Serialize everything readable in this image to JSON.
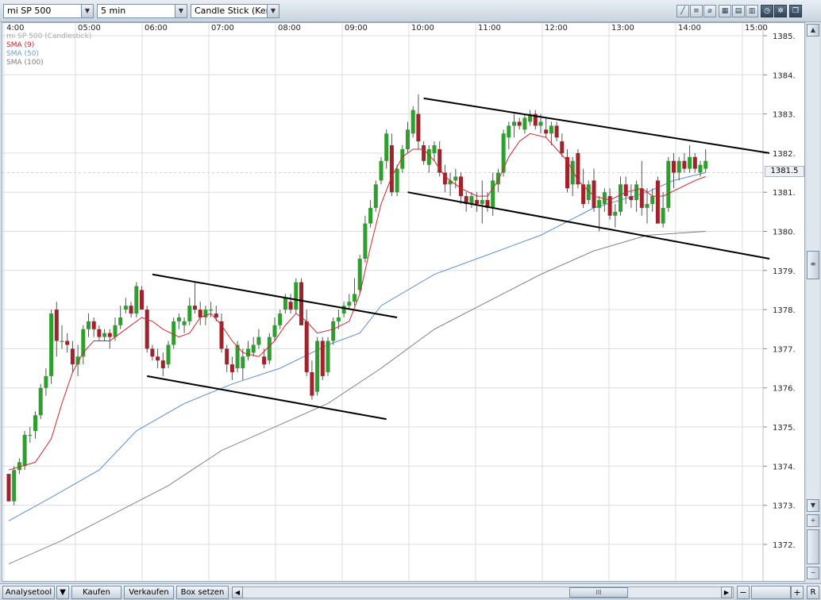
{
  "toolbar": {
    "symbol": "mi SP 500",
    "interval": "5 min",
    "chart_style": "Candle Stick (Kerze"
  },
  "legend": {
    "instrument": "mi SP 500 (Candlestick)",
    "sma9": "SMA (9)",
    "sma50": "SMA (50)",
    "sma100": "SMA (100)"
  },
  "last_price": "1381.5",
  "colors": {
    "up": "#2e9e2e",
    "down": "#a0222a",
    "sma9": "#d0262d",
    "sma50": "#5b8fd6",
    "sma100": "#777777",
    "trendline": "#000000",
    "grid": "#d9dde2"
  },
  "bottom": {
    "tab1": "Analysetool",
    "tab2": "Kaufen",
    "tab3": "Verkaufen",
    "tab4": "Box setzen",
    "r_label": "R",
    "thumb_grip": "III"
  },
  "chart_data": {
    "type": "candlestick",
    "interval_minutes": 5,
    "x_ticks": [
      "4:00",
      "05:00",
      "06:00",
      "07:00",
      "08:00",
      "09:00",
      "10:00",
      "11:00",
      "12:00",
      "13:00",
      "14:00",
      "15:00"
    ],
    "y_ticks": [
      "1372.",
      "1373.",
      "1374.",
      "1375.",
      "1376.",
      "1377.",
      "1378.",
      "1379.",
      "1380.",
      "1381.",
      "1382.",
      "1383.",
      "1384.",
      "1385."
    ],
    "ylim": [
      1371.4,
      1385.2
    ],
    "grid": true,
    "candles": [
      [
        1373.8,
        1373.8,
        1373.1,
        1373.1
      ],
      [
        1373.1,
        1374.0,
        1373.0,
        1373.9
      ],
      [
        1373.9,
        1374.2,
        1373.8,
        1374.1
      ],
      [
        1374.0,
        1374.9,
        1373.9,
        1374.8
      ],
      [
        1374.8,
        1375.0,
        1374.6,
        1374.8
      ],
      [
        1374.9,
        1375.4,
        1374.7,
        1375.3
      ],
      [
        1375.3,
        1376.1,
        1375.2,
        1376.0
      ],
      [
        1376.0,
        1376.5,
        1375.8,
        1376.3
      ],
      [
        1376.3,
        1378.0,
        1376.1,
        1377.9
      ],
      [
        1378.0,
        1378.2,
        1376.8,
        1377.2
      ],
      [
        1377.2,
        1377.6,
        1377.0,
        1377.2
      ],
      [
        1377.2,
        1377.4,
        1376.9,
        1377.1
      ],
      [
        1377.0,
        1377.2,
        1376.4,
        1376.6
      ],
      [
        1376.6,
        1377.1,
        1376.3,
        1376.8
      ],
      [
        1376.8,
        1377.6,
        1376.6,
        1377.5
      ],
      [
        1377.5,
        1377.9,
        1377.3,
        1377.7
      ],
      [
        1377.7,
        1377.8,
        1377.3,
        1377.5
      ],
      [
        1377.5,
        1377.6,
        1377.2,
        1377.3
      ],
      [
        1377.3,
        1377.5,
        1377.2,
        1377.4
      ],
      [
        1377.4,
        1377.5,
        1377.0,
        1377.3
      ],
      [
        1377.3,
        1377.8,
        1377.2,
        1377.6
      ],
      [
        1377.6,
        1378.1,
        1377.5,
        1377.8
      ],
      [
        1378.0,
        1378.3,
        1377.9,
        1378.1
      ],
      [
        1378.1,
        1378.2,
        1377.8,
        1377.9
      ],
      [
        1377.9,
        1378.7,
        1377.8,
        1378.6
      ],
      [
        1378.5,
        1378.6,
        1378.0,
        1378.0
      ],
      [
        1378.0,
        1378.1,
        1376.9,
        1377.0
      ],
      [
        1377.0,
        1377.1,
        1376.7,
        1376.8
      ],
      [
        1376.8,
        1377.0,
        1376.5,
        1376.7
      ],
      [
        1376.7,
        1376.9,
        1376.3,
        1376.5
      ],
      [
        1376.6,
        1377.2,
        1376.5,
        1377.1
      ],
      [
        1377.1,
        1377.8,
        1377.0,
        1377.7
      ],
      [
        1377.7,
        1377.9,
        1377.5,
        1377.8
      ],
      [
        1377.6,
        1377.8,
        1377.4,
        1377.7
      ],
      [
        1377.7,
        1378.3,
        1377.6,
        1378.1
      ],
      [
        1378.1,
        1378.7,
        1377.9,
        1378.0
      ],
      [
        1378.0,
        1378.2,
        1377.6,
        1377.8
      ],
      [
        1377.8,
        1378.1,
        1377.6,
        1378.0
      ],
      [
        1378.0,
        1378.2,
        1377.8,
        1378.0
      ],
      [
        1377.9,
        1378.1,
        1377.7,
        1377.8
      ],
      [
        1377.7,
        1377.9,
        1376.9,
        1377.0
      ],
      [
        1377.0,
        1377.1,
        1376.4,
        1376.6
      ],
      [
        1376.6,
        1376.8,
        1376.2,
        1376.4
      ],
      [
        1376.5,
        1377.2,
        1376.4,
        1377.1
      ],
      [
        1376.5,
        1377.0,
        1376.2,
        1376.8
      ],
      [
        1376.8,
        1377.2,
        1376.7,
        1377.0
      ],
      [
        1376.9,
        1377.3,
        1376.8,
        1377.1
      ],
      [
        1377.1,
        1377.5,
        1377.0,
        1377.3
      ],
      [
        1376.8,
        1377.0,
        1376.5,
        1376.6
      ],
      [
        1376.7,
        1377.4,
        1376.6,
        1377.3
      ],
      [
        1377.3,
        1377.8,
        1377.2,
        1377.6
      ],
      [
        1377.6,
        1378.0,
        1377.5,
        1377.9
      ],
      [
        1378.0,
        1378.4,
        1377.9,
        1378.3
      ],
      [
        1378.2,
        1378.4,
        1377.9,
        1378.0
      ],
      [
        1378.0,
        1378.8,
        1377.9,
        1378.7
      ],
      [
        1378.7,
        1378.8,
        1377.6,
        1377.6
      ],
      [
        1377.7,
        1378.0,
        1376.3,
        1376.4
      ],
      [
        1376.4,
        1376.7,
        1375.7,
        1375.8
      ],
      [
        1375.9,
        1377.3,
        1375.8,
        1377.2
      ],
      [
        1377.2,
        1377.3,
        1376.2,
        1376.3
      ],
      [
        1376.4,
        1377.3,
        1376.3,
        1377.2
      ],
      [
        1377.2,
        1377.8,
        1377.1,
        1377.7
      ],
      [
        1377.7,
        1378.0,
        1377.5,
        1377.8
      ],
      [
        1377.9,
        1378.2,
        1377.8,
        1378.1
      ],
      [
        1378.1,
        1378.4,
        1378.0,
        1378.2
      ],
      [
        1378.2,
        1378.8,
        1378.1,
        1378.4
      ],
      [
        1378.5,
        1379.4,
        1378.4,
        1379.3
      ],
      [
        1379.3,
        1380.4,
        1379.2,
        1380.2
      ],
      [
        1380.2,
        1380.8,
        1380.1,
        1380.6
      ],
      [
        1380.6,
        1381.3,
        1380.5,
        1381.2
      ],
      [
        1381.3,
        1381.9,
        1381.2,
        1381.8
      ],
      [
        1381.8,
        1382.6,
        1381.6,
        1382.5
      ],
      [
        1382.2,
        1382.5,
        1380.9,
        1381.0
      ],
      [
        1381.0,
        1381.7,
        1380.9,
        1381.6
      ],
      [
        1381.6,
        1382.2,
        1381.5,
        1382.1
      ],
      [
        1382.1,
        1382.8,
        1382.0,
        1382.6
      ],
      [
        1382.5,
        1383.2,
        1382.4,
        1383.1
      ],
      [
        1383.0,
        1383.5,
        1382.1,
        1382.3
      ],
      [
        1382.2,
        1382.3,
        1381.7,
        1381.8
      ],
      [
        1381.7,
        1382.2,
        1381.5,
        1382.1
      ],
      [
        1382.0,
        1382.3,
        1381.8,
        1382.2
      ],
      [
        1382.1,
        1382.3,
        1381.4,
        1381.5
      ],
      [
        1381.5,
        1381.7,
        1381.0,
        1381.2
      ],
      [
        1381.2,
        1381.5,
        1380.9,
        1381.3
      ],
      [
        1381.3,
        1381.6,
        1381.1,
        1381.4
      ],
      [
        1381.4,
        1381.5,
        1380.7,
        1380.9
      ],
      [
        1380.9,
        1381.0,
        1380.5,
        1380.7
      ],
      [
        1380.7,
        1381.0,
        1380.6,
        1380.9
      ],
      [
        1380.8,
        1381.0,
        1380.5,
        1380.7
      ],
      [
        1380.7,
        1381.3,
        1380.2,
        1380.8
      ],
      [
        1380.8,
        1381.0,
        1380.5,
        1380.6
      ],
      [
        1380.6,
        1381.5,
        1380.4,
        1381.3
      ],
      [
        1381.2,
        1381.6,
        1381.0,
        1381.5
      ],
      [
        1381.5,
        1382.6,
        1381.4,
        1382.5
      ],
      [
        1382.4,
        1382.8,
        1382.1,
        1382.7
      ],
      [
        1382.7,
        1383.0,
        1382.4,
        1382.8
      ],
      [
        1382.8,
        1382.9,
        1382.6,
        1382.7
      ],
      [
        1382.6,
        1383.0,
        1382.5,
        1382.9
      ],
      [
        1382.8,
        1383.1,
        1382.7,
        1383.0
      ],
      [
        1383.0,
        1383.1,
        1382.6,
        1382.7
      ],
      [
        1382.7,
        1383.0,
        1382.5,
        1382.8
      ],
      [
        1382.6,
        1382.9,
        1382.4,
        1382.5
      ],
      [
        1382.5,
        1382.8,
        1382.2,
        1382.7
      ],
      [
        1382.7,
        1382.8,
        1382.3,
        1382.4
      ],
      [
        1382.3,
        1382.5,
        1381.9,
        1382.0
      ],
      [
        1381.9,
        1382.1,
        1381.0,
        1381.1
      ],
      [
        1381.2,
        1381.9,
        1380.9,
        1381.8
      ],
      [
        1382.0,
        1382.1,
        1381.1,
        1381.2
      ],
      [
        1381.2,
        1381.6,
        1380.6,
        1380.7
      ],
      [
        1380.8,
        1381.3,
        1380.7,
        1381.2
      ],
      [
        1381.3,
        1381.6,
        1380.5,
        1380.6
      ],
      [
        1380.6,
        1380.9,
        1380.0,
        1380.8
      ],
      [
        1380.7,
        1381.1,
        1380.5,
        1381.0
      ],
      [
        1380.9,
        1381.1,
        1380.3,
        1380.4
      ],
      [
        1380.4,
        1380.7,
        1380.1,
        1380.5
      ],
      [
        1380.5,
        1381.4,
        1380.4,
        1381.2
      ],
      [
        1381.2,
        1381.4,
        1380.7,
        1380.9
      ],
      [
        1380.9,
        1381.2,
        1380.6,
        1380.8
      ],
      [
        1380.8,
        1381.3,
        1380.5,
        1381.2
      ],
      [
        1381.1,
        1381.8,
        1380.4,
        1380.6
      ],
      [
        1380.6,
        1381.1,
        1380.2,
        1380.7
      ],
      [
        1380.7,
        1381.1,
        1380.5,
        1380.9
      ],
      [
        1381.3,
        1381.4,
        1380.2,
        1380.2
      ],
      [
        1380.2,
        1381.0,
        1380.1,
        1380.6
      ],
      [
        1380.6,
        1381.9,
        1380.5,
        1381.8
      ],
      [
        1381.8,
        1382.0,
        1381.1,
        1381.5
      ],
      [
        1381.5,
        1381.9,
        1381.3,
        1381.8
      ],
      [
        1381.8,
        1382.0,
        1381.5,
        1381.6
      ],
      [
        1381.6,
        1382.2,
        1381.5,
        1381.9
      ],
      [
        1381.9,
        1382.0,
        1381.5,
        1381.6
      ],
      [
        1381.5,
        1381.8,
        1381.4,
        1381.7
      ],
      [
        1381.6,
        1382.1,
        1381.5,
        1381.8
      ]
    ],
    "sma9": [
      [
        0,
        1373.9
      ],
      [
        5,
        1374.1
      ],
      [
        8,
        1374.7
      ],
      [
        10,
        1375.6
      ],
      [
        12,
        1376.4
      ],
      [
        14,
        1376.9
      ],
      [
        16,
        1377.2
      ],
      [
        19,
        1377.2
      ],
      [
        22,
        1377.5
      ],
      [
        25,
        1377.8
      ],
      [
        27,
        1377.7
      ],
      [
        29,
        1377.5
      ],
      [
        32,
        1377.3
      ],
      [
        34,
        1377.4
      ],
      [
        36,
        1377.8
      ],
      [
        38,
        1377.9
      ],
      [
        40,
        1377.6
      ],
      [
        42,
        1377.2
      ],
      [
        44,
        1376.9
      ],
      [
        47,
        1376.8
      ],
      [
        50,
        1377.2
      ],
      [
        52,
        1377.6
      ],
      [
        54,
        1377.9
      ],
      [
        56,
        1377.7
      ],
      [
        58,
        1377.4
      ],
      [
        61,
        1377.5
      ],
      [
        64,
        1377.7
      ],
      [
        66,
        1378.4
      ],
      [
        68,
        1379.6
      ],
      [
        70,
        1380.7
      ],
      [
        72,
        1381.4
      ],
      [
        74,
        1381.9
      ],
      [
        76,
        1382.1
      ],
      [
        78,
        1382.1
      ],
      [
        80,
        1381.8
      ],
      [
        82,
        1381.4
      ],
      [
        85,
        1381.1
      ],
      [
        88,
        1380.9
      ],
      [
        90,
        1380.9
      ],
      [
        92,
        1381.3
      ],
      [
        94,
        1381.9
      ],
      [
        96,
        1382.3
      ],
      [
        98,
        1382.5
      ],
      [
        101,
        1382.4
      ],
      [
        103,
        1382.1
      ],
      [
        105,
        1381.8
      ],
      [
        107,
        1381.3
      ],
      [
        110,
        1380.9
      ],
      [
        113,
        1380.8
      ],
      [
        116,
        1381.0
      ],
      [
        119,
        1381.1
      ],
      [
        121,
        1380.9
      ],
      [
        123,
        1380.9
      ],
      [
        126,
        1381.1
      ],
      [
        129,
        1381.3
      ],
      [
        131,
        1381.4
      ]
    ],
    "sma50": [
      [
        0,
        1372.6
      ],
      [
        8,
        1373.2
      ],
      [
        17,
        1373.9
      ],
      [
        24,
        1374.9
      ],
      [
        33,
        1375.6
      ],
      [
        42,
        1376.1
      ],
      [
        51,
        1376.5
      ],
      [
        60,
        1377.1
      ],
      [
        66,
        1377.4
      ],
      [
        70,
        1378.1
      ],
      [
        80,
        1378.9
      ],
      [
        90,
        1379.4
      ],
      [
        100,
        1379.9
      ],
      [
        110,
        1380.6
      ],
      [
        120,
        1381.0
      ],
      [
        125,
        1381.3
      ],
      [
        131,
        1381.5
      ]
    ],
    "sma100": [
      [
        0,
        1371.5
      ],
      [
        10,
        1372.1
      ],
      [
        20,
        1372.8
      ],
      [
        30,
        1373.5
      ],
      [
        40,
        1374.4
      ],
      [
        50,
        1375.0
      ],
      [
        60,
        1375.6
      ],
      [
        70,
        1376.5
      ],
      [
        80,
        1377.5
      ],
      [
        90,
        1378.2
      ],
      [
        100,
        1378.9
      ],
      [
        110,
        1379.5
      ],
      [
        120,
        1379.9
      ],
      [
        131,
        1380.0
      ]
    ],
    "trendlines": [
      {
        "from": [
          27,
          1378.9
        ],
        "to": [
          73,
          1377.8
        ]
      },
      {
        "from": [
          26,
          1376.3
        ],
        "to": [
          71,
          1375.2
        ]
      },
      {
        "from": [
          78,
          1383.4
        ],
        "to": [
          143,
          1382.0
        ]
      },
      {
        "from": [
          75,
          1381.0
        ],
        "to": [
          143,
          1379.3
        ]
      }
    ]
  }
}
